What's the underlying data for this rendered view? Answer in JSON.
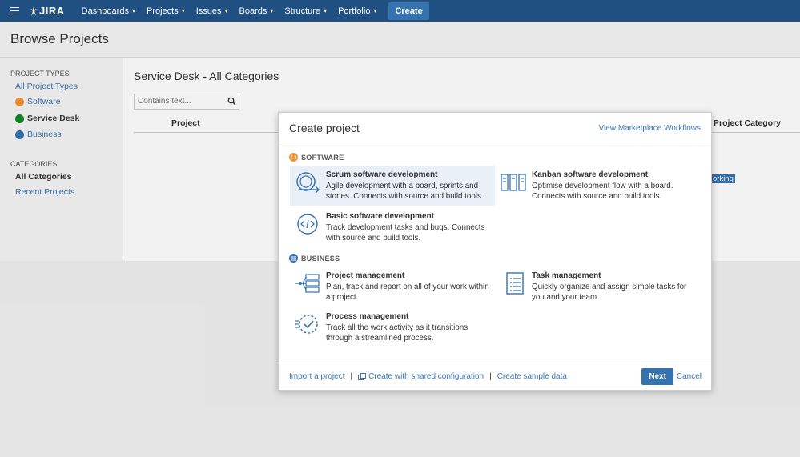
{
  "nav": {
    "logo": "JIRA",
    "items": [
      "Dashboards",
      "Projects",
      "Issues",
      "Boards",
      "Structure",
      "Portfolio"
    ],
    "create": "Create"
  },
  "page": {
    "title": "Browse Projects"
  },
  "sidebar": {
    "types_heading": "PROJECT TYPES",
    "all_types": "All Project Types",
    "software": "Software",
    "service_desk": "Service Desk",
    "business": "Business",
    "categories_heading": "CATEGORIES",
    "all_categories": "All Categories",
    "recent": "Recent Projects"
  },
  "main": {
    "title": "Service Desk - All Categories",
    "search_placeholder": "Contains text...",
    "col_project": "Project",
    "col_category": "Project Category",
    "tag": "orking"
  },
  "dialog": {
    "title": "Create project",
    "marketplace": "View Marketplace Workflows",
    "software_heading": "SOFTWARE",
    "business_heading": "BUSINESS",
    "templates": {
      "scrum": {
        "name": "Scrum software development",
        "desc": "Agile development with a board, sprints and stories. Connects with source and build tools."
      },
      "kanban": {
        "name": "Kanban software development",
        "desc": "Optimise development flow with a board. Connects with source and build tools."
      },
      "basic": {
        "name": "Basic software development",
        "desc": "Track development tasks and bugs. Connects with source and build tools."
      },
      "project_mgmt": {
        "name": "Project management",
        "desc": "Plan, track and report on all of your work within a project."
      },
      "task_mgmt": {
        "name": "Task management",
        "desc": "Quickly organize and assign simple tasks for you and your team."
      },
      "process_mgmt": {
        "name": "Process management",
        "desc": "Track all the work activity as it transitions through a streamlined process."
      }
    },
    "footer": {
      "import": "Import a project",
      "shared": "Create with shared configuration",
      "sample": "Create sample data",
      "sep": "|",
      "next": "Next",
      "cancel": "Cancel"
    }
  },
  "colors": {
    "nav_bg": "#205081",
    "accent": "#3572b0",
    "link": "#3b73af",
    "software": "#f79232",
    "service_desk": "#14892c",
    "business": "#3572b0"
  }
}
